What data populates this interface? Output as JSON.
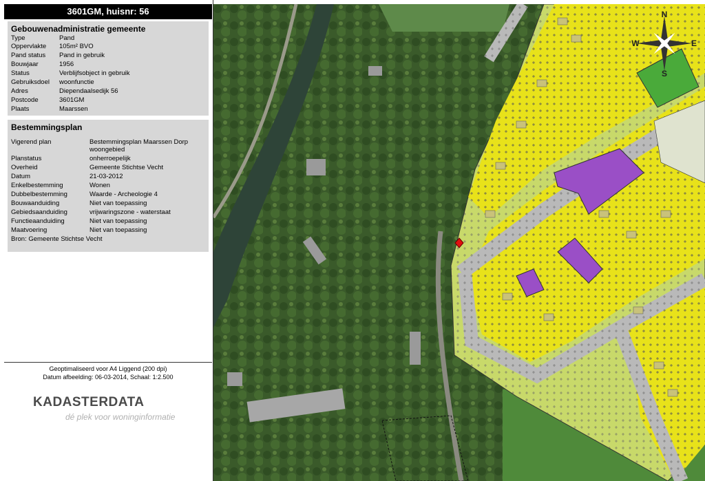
{
  "header": {
    "title": "3601GM, huisnr: 56"
  },
  "building": {
    "heading": "Gebouwenadministratie gemeente",
    "rows": [
      {
        "label": "Type",
        "value": "Pand"
      },
      {
        "label": "Oppervlakte",
        "value": "105m² BVO"
      },
      {
        "label": "Pand status",
        "value": "Pand in gebruik"
      },
      {
        "label": "Bouwjaar",
        "value": "1956"
      },
      {
        "label": "Status",
        "value": "Verblijfsobject in gebruik"
      },
      {
        "label": "Gebruiksdoel",
        "value": "woonfunctie"
      },
      {
        "label": "Adres",
        "value": "Diependaalsedijk 56"
      },
      {
        "label": "Postcode",
        "value": "3601GM"
      },
      {
        "label": "Plaats",
        "value": "Maarssen"
      }
    ]
  },
  "zoning": {
    "heading": "Bestemmingsplan",
    "rows": [
      {
        "label": "Vigerend plan",
        "value": "Bestemmingsplan Maarssen Dorp",
        "value2": "woongebied"
      },
      {
        "label": "Planstatus",
        "value": "onherroepelijk"
      },
      {
        "label": "Overheid",
        "value": "Gemeente Stichtse Vecht"
      },
      {
        "label": "Datum",
        "value": "21-03-2012"
      },
      {
        "label": "Enkelbestemming",
        "value": "Wonen"
      },
      {
        "label": "Dubbelbestemming",
        "value": "Waarde - Archeologie 4"
      },
      {
        "label": "Bouwaanduiding",
        "value": "Niet van toepassing"
      },
      {
        "label": "Gebiedsaanduiding",
        "value": "vrijwaringszone - waterstaat"
      },
      {
        "label": "Functieaanduiding",
        "value": "Niet van toepassing"
      },
      {
        "label": "Maatvoering",
        "value": "Niet van toepassing"
      }
    ],
    "source": "Bron: Gemeente Stichtse Vecht"
  },
  "footer": {
    "line1": "Geoptimaliseerd voor A4 Liggend (200 dpi)",
    "line2": "Datum afbeelding: 06-03-2014, Schaal: 1:2.500",
    "brand": "KADASTERDATA",
    "tagline": "dé plek voor woninginformatie"
  },
  "map": {
    "compass": {
      "n": "N",
      "e": "E",
      "s": "S",
      "w": "W"
    },
    "colors": {
      "residential": "#e8e21a",
      "garden": "#c8d96a",
      "road": "#b9b9b9",
      "social": "#9a4fc6",
      "green": "#4aaa3a",
      "water": "#3d5a4a"
    }
  }
}
